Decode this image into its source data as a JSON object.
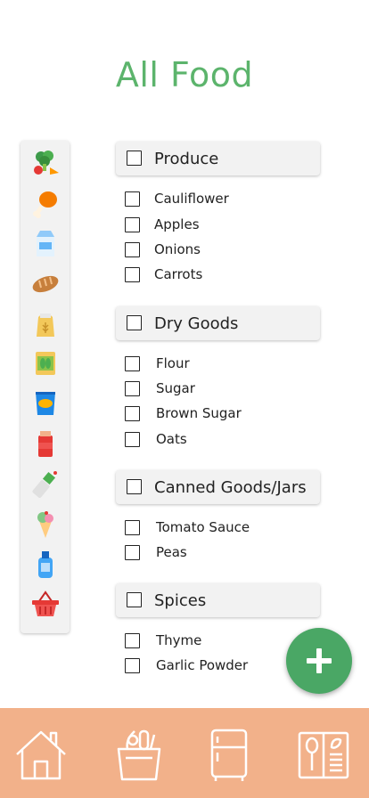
{
  "page": {
    "title": "All Food"
  },
  "sidebar": {
    "icons": [
      "produce-icon",
      "meat-icon",
      "dairy-icon",
      "bread-icon",
      "flour-sack-icon",
      "canned-goods-icon",
      "snacks-icon",
      "spice-jar-icon",
      "condiments-icon",
      "dessert-icon",
      "cleaning-icon",
      "basket-icon"
    ]
  },
  "categories": [
    {
      "name": "Produce",
      "items": [
        "Cauliflower",
        "Apples",
        "Onions",
        "Carrots"
      ]
    },
    {
      "name": "Dry Goods",
      "items": [
        "Flour",
        "Sugar",
        "Brown Sugar",
        "Oats"
      ]
    },
    {
      "name": "Canned Goods/Jars",
      "items": [
        "Tomato Sauce",
        "Peas"
      ]
    },
    {
      "name": "Spices",
      "items": [
        "Thyme",
        "Garlic Powder"
      ]
    }
  ],
  "fab": {
    "icon": "plus-icon"
  },
  "bottom_nav": {
    "icons": [
      "home-icon",
      "groceries-icon",
      "fridge-icon",
      "recipe-book-icon"
    ]
  },
  "colors": {
    "accent": "#5cb46c",
    "fab": "#4aa765",
    "nav_bg": "#f2b18a"
  }
}
